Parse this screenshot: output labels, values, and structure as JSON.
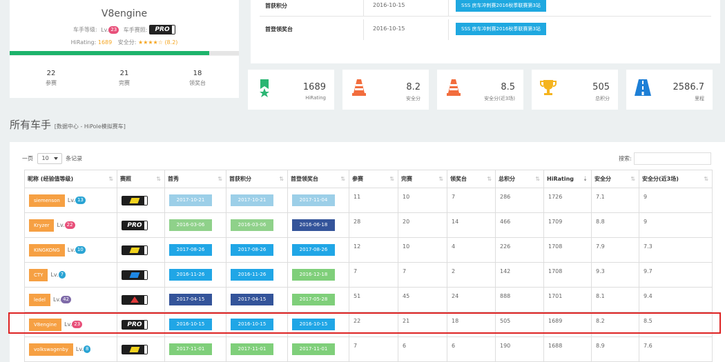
{
  "profile": {
    "name": "V8engine",
    "driver_level_label": "车手等级:",
    "level_prefix": "Lv.",
    "level_value": "23",
    "license_label": "车手赛照:",
    "license_text": "PRO",
    "hirating_label": "HiRating:",
    "hirating_value": "1689",
    "safety_label": "安全分:",
    "safety_stars": "★★★★☆",
    "safety_value": "(8.2)",
    "progress_fraction": 0.87,
    "counts": [
      {
        "value": "22",
        "label": "参赛"
      },
      {
        "value": "21",
        "label": "完赛"
      },
      {
        "value": "18",
        "label": "领奖台"
      }
    ]
  },
  "awards": [
    {
      "label": "首获积分",
      "date": "2016-10-15",
      "event": "SSS 房车冲刺赛2016秋季联赛第3站"
    },
    {
      "label": "首登领奖台",
      "date": "2016-10-15",
      "event": "SSS 房车冲刺赛2016秋季联赛第3站"
    }
  ],
  "stats": [
    {
      "value": "1689",
      "label": "HiRating",
      "icon": "medal-icon"
    },
    {
      "value": "8.2",
      "label": "安全分",
      "icon": "traffic-cone-icon"
    },
    {
      "value": "8.5",
      "label": "安全分(近3场)",
      "icon": "traffic-cone-icon"
    },
    {
      "value": "505",
      "label": "总积分",
      "icon": "trophy-icon"
    },
    {
      "value": "2586.7",
      "label": "里程",
      "icon": "road-icon"
    }
  ],
  "section": {
    "title": "所有车手",
    "subtitle": "[数据中心 - HiPole模拟赛车]"
  },
  "table_controls": {
    "page_prefix": "一页",
    "page_size": "10",
    "page_suffix": "条记录",
    "search_label": "搜索:"
  },
  "table": {
    "headers": [
      "昵称 (经验值等级)",
      "赛照",
      "首秀",
      "首获积分",
      "首登领奖台",
      "参赛",
      "完赛",
      "领奖台",
      "总积分",
      "HiRating",
      "安全分",
      "安全分(近3场)"
    ],
    "rows": [
      {
        "nick": "siemenson",
        "lv": "13",
        "lvcolor": "blue",
        "license": "B",
        "debut": "2017-10-21",
        "first_points": "2017-10-21",
        "first_podium": "2017-11-04",
        "c_debut": "lightblue",
        "c_points": "lightblue",
        "c_podium": "lightblue",
        "races": "11",
        "finished": "10",
        "podiums": "7",
        "points": "286",
        "hirating": "1726",
        "safety": "7.1",
        "safety3": "9"
      },
      {
        "nick": "Kryzer",
        "lv": "22",
        "lvcolor": "pink",
        "license": "PRO",
        "debut": "2016-03-06",
        "first_points": "2016-03-06",
        "first_podium": "2016-06-18",
        "c_debut": "green",
        "c_points": "green",
        "c_podium": "navy",
        "races": "28",
        "finished": "20",
        "podiums": "14",
        "points": "466",
        "hirating": "1709",
        "safety": "8.8",
        "safety3": "9"
      },
      {
        "nick": "KINGKONG",
        "lv": "10",
        "lvcolor": "blue",
        "license": "B",
        "debut": "2017-08-26",
        "first_points": "2017-08-26",
        "first_podium": "2017-08-26",
        "c_debut": "blue",
        "c_points": "blue",
        "c_podium": "blue",
        "races": "12",
        "finished": "10",
        "podiums": "4",
        "points": "226",
        "hirating": "1708",
        "safety": "7.9",
        "safety3": "7.3"
      },
      {
        "nick": "CTY",
        "lv": "7",
        "lvcolor": "blue",
        "license": "C",
        "debut": "2016-11-26",
        "first_points": "2016-11-26",
        "first_podium": "2016-12-18",
        "c_debut": "blue",
        "c_points": "blue",
        "c_podium": "greenalt",
        "races": "7",
        "finished": "7",
        "podiums": "2",
        "points": "142",
        "hirating": "1708",
        "safety": "9.3",
        "safety3": "9.7"
      },
      {
        "nick": "ledel",
        "lv": "42",
        "lvcolor": "purple",
        "license": "A",
        "debut": "2017-04-15",
        "first_points": "2017-04-15",
        "first_podium": "2017-05-28",
        "c_debut": "navy",
        "c_points": "navy",
        "c_podium": "greenalt",
        "races": "51",
        "finished": "45",
        "podiums": "24",
        "points": "888",
        "hirating": "1701",
        "safety": "8.1",
        "safety3": "9.4"
      },
      {
        "nick": "V8engine",
        "lv": "23",
        "lvcolor": "pink",
        "license": "PRO",
        "debut": "2016-10-15",
        "first_points": "2016-10-15",
        "first_podium": "2016-10-15",
        "c_debut": "blue",
        "c_points": "blue",
        "c_podium": "blue",
        "races": "22",
        "finished": "21",
        "podiums": "18",
        "points": "505",
        "hirating": "1689",
        "safety": "8.2",
        "safety3": "8.5"
      },
      {
        "nick": "volkswagenby",
        "lv": "8",
        "lvcolor": "blue",
        "license": "B",
        "debut": "2017-11-01",
        "first_points": "2017-11-01",
        "first_podium": "2017-11-01",
        "c_debut": "greenalt",
        "c_points": "greenalt",
        "c_podium": "greenalt",
        "races": "7",
        "finished": "6",
        "podiums": "6",
        "points": "190",
        "hirating": "1688",
        "safety": "8.9",
        "safety3": "7.6"
      }
    ]
  },
  "colors": {
    "accent_blue": "#1fa8e0",
    "nick_orange": "#f6a043",
    "progress_green": "#1db36b",
    "highlight_red": "#dd2222"
  }
}
